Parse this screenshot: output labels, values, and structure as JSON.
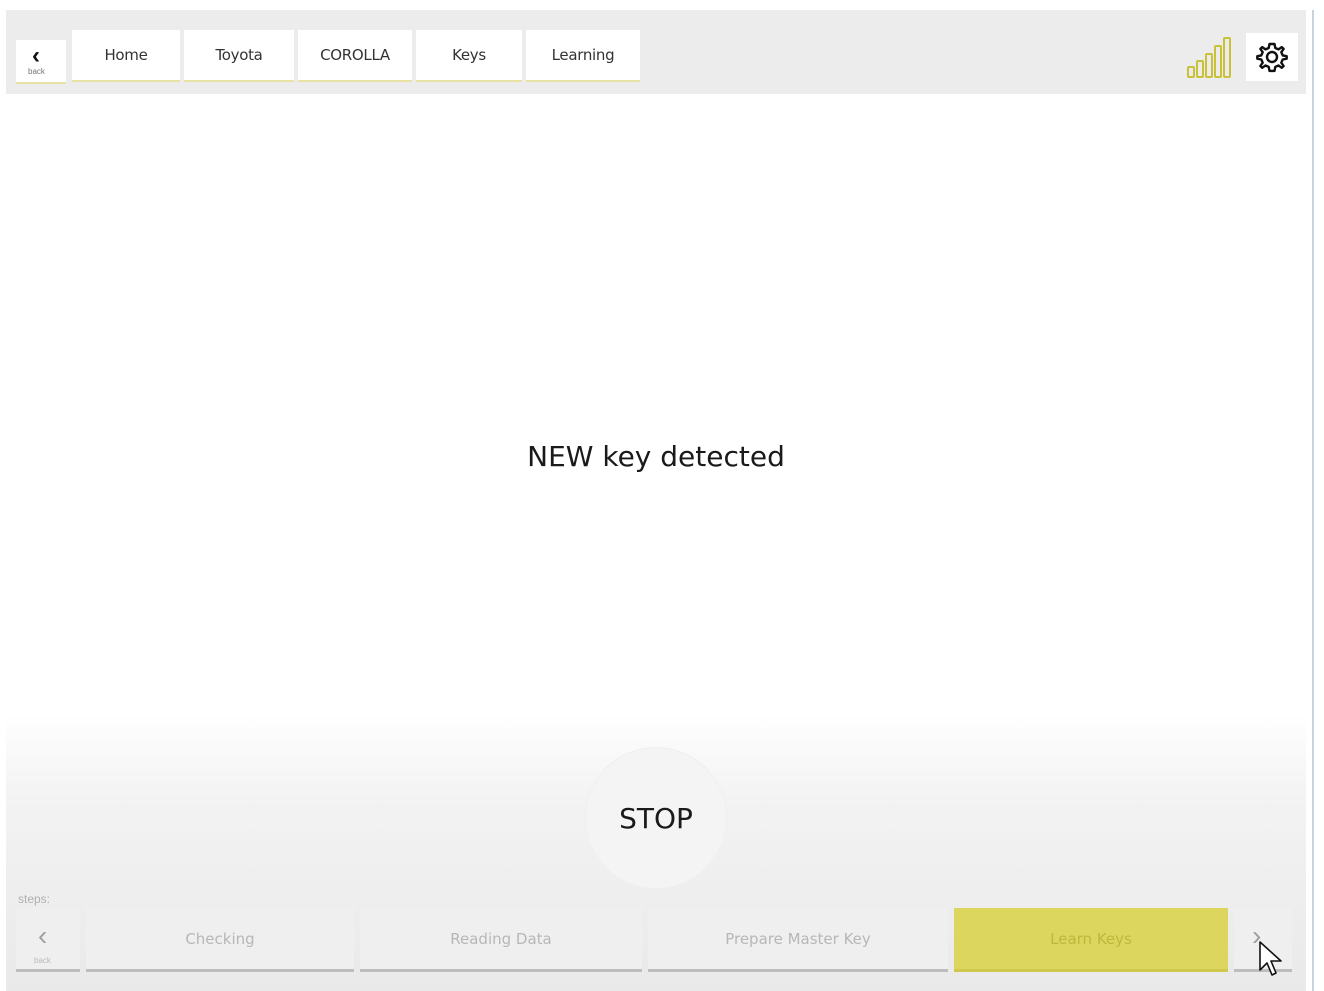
{
  "header": {
    "back_label": "back",
    "breadcrumbs": [
      "Home",
      "Toyota",
      "COROLLA",
      "Keys",
      "Learning"
    ],
    "signal_bars": 5
  },
  "main": {
    "message": "NEW key detected",
    "stop_label": "STOP"
  },
  "steps": {
    "label": "steps:",
    "back_label": "back",
    "items": [
      "Checking",
      "Reading Data",
      "Prepare Master Key",
      "Learn Keys"
    ],
    "active_index": 3
  },
  "colors": {
    "accent": "#dcd65e",
    "accent_underline": "#e8e2a6",
    "signal": "#c9c238"
  }
}
